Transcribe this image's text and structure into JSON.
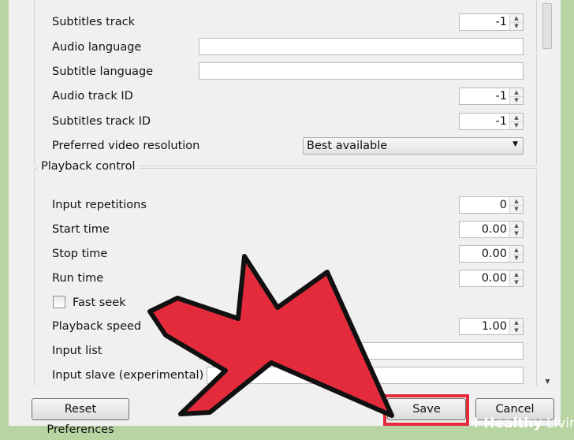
{
  "input_section": {
    "rows": {
      "subtitles_track": {
        "label": "Subtitles track",
        "value": "-1"
      },
      "audio_language": {
        "label": "Audio language",
        "value": ""
      },
      "subtitle_language": {
        "label": "Subtitle language",
        "value": ""
      },
      "audio_track_id": {
        "label": "Audio track ID",
        "value": "-1"
      },
      "subtitles_track_id": {
        "label": "Subtitles track ID",
        "value": "-1"
      },
      "preferred_video_resolution": {
        "label": "Preferred video resolution",
        "value": "Best available"
      }
    }
  },
  "playback_control": {
    "title": "Playback control",
    "rows": {
      "input_repetitions": {
        "label": "Input repetitions",
        "value": "0"
      },
      "start_time": {
        "label": "Start time",
        "value": "0.00"
      },
      "stop_time": {
        "label": "Stop time",
        "value": "0.00"
      },
      "run_time": {
        "label": "Run time",
        "value": "0.00"
      },
      "fast_seek": {
        "label": "Fast seek",
        "checked": false
      },
      "playback_speed": {
        "label": "Playback speed",
        "value": "1.00"
      },
      "input_list": {
        "label": "Input list",
        "value": ""
      },
      "input_slave": {
        "label": "Input slave (experimental)",
        "value": ""
      }
    }
  },
  "buttons": {
    "reset": "Reset Preferences",
    "save": "Save",
    "cancel": "Cancel"
  },
  "overlay": {
    "arrow_color": "#e32b3b",
    "highlight_color": "#e32b3b"
  },
  "brand": {
    "icon": "plus-cross-icon",
    "bold": "Healthy",
    "rest": " Living"
  }
}
